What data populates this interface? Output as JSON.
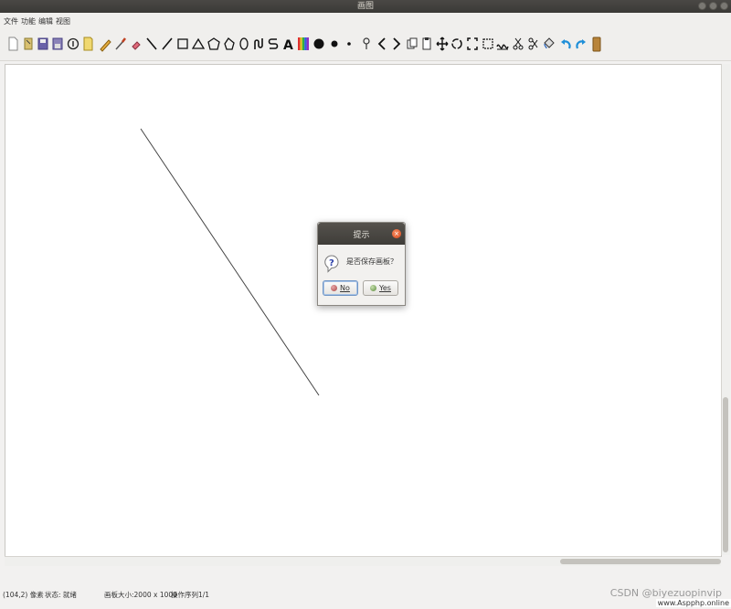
{
  "window": {
    "title": "画图"
  },
  "menu": [
    {
      "label": "文件"
    },
    {
      "label": "功能"
    },
    {
      "label": "编辑"
    },
    {
      "label": "视图"
    }
  ],
  "toolbar": {
    "tools": [
      "new-file-icon",
      "open-file-icon",
      "save-icon",
      "save-as-icon",
      "info-icon",
      "note-icon",
      "pencil-icon",
      "brush-icon",
      "eraser-icon",
      "backslash-line-icon",
      "slash-line-icon",
      "rectangle-icon",
      "triangle-icon",
      "pentagon-icon",
      "polygon-icon",
      "ellipse-icon",
      "curve-icon",
      "s-curve-icon",
      "text-icon",
      "color-palette-icon",
      "filled-circle-icon",
      "large-dot-icon",
      "small-dot-icon",
      "pin-icon",
      "undo-step-icon",
      "redo-step-icon",
      "copy-icon",
      "paste-icon",
      "move-icon",
      "rotate-icon",
      "fit-screen-icon",
      "crop-icon",
      "wave-icon",
      "cut-icon",
      "scissors-icon",
      "fill-icon",
      "undo-icon",
      "redo-icon",
      "clear-icon"
    ]
  },
  "dialog": {
    "title": "提示",
    "message": "是否保存画板？",
    "no_label": "No",
    "yes_label": "Yes"
  },
  "status": {
    "coords": "(104,2) 像素",
    "state": "状态: 就绪",
    "canvas_size": "画板大小:2000 x 1000",
    "sequence": "操作序列1/1"
  },
  "watermark": {
    "csdn": "CSDN @biyezuopinvip",
    "site": "www.Aspphp.online"
  },
  "colors": {
    "titlebar": "#3f3d39",
    "close_button": "#e0592a",
    "undo_blue": "#1f8fd8",
    "canvas_bg": "#ffffff"
  }
}
